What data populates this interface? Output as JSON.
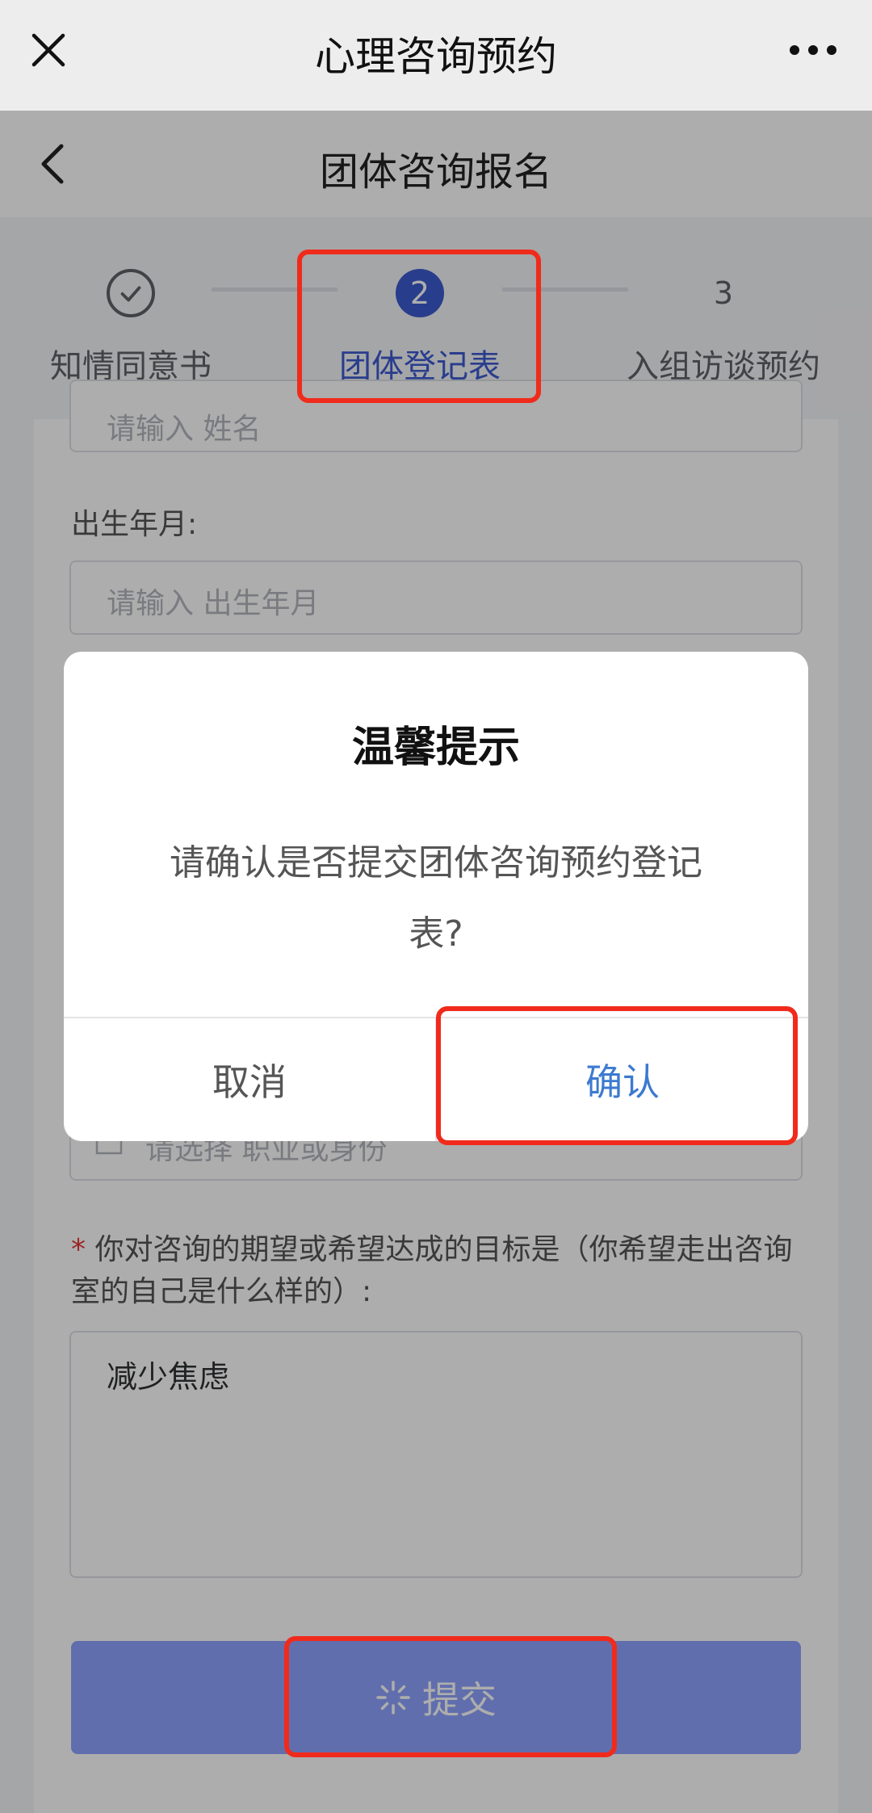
{
  "wechat_bar": {
    "title": "心理咨询预约"
  },
  "header": {
    "title": "团体咨询报名"
  },
  "steps": [
    {
      "index": "",
      "label": "知情同意书",
      "state": "done"
    },
    {
      "index": "2",
      "label": "团体登记表",
      "state": "active"
    },
    {
      "index": "3",
      "label": "入组访谈预约",
      "state": "pending"
    }
  ],
  "form": {
    "name_placeholder_partial": "请输入 姓名",
    "birth_label": "出生年月:",
    "birth_placeholder": "请输入 出生年月",
    "occupation_placeholder": "请选择 职业或身份",
    "goal_required_mark": "*",
    "goal_label": "你对咨询的期望或希望达成的目标是（你希望走出咨询室的自己是什么样的）:",
    "goal_value": "减少焦虑",
    "submit_label": "提交"
  },
  "dialog": {
    "title": "温馨提示",
    "message": "请确认是否提交团体咨询预约登记表?",
    "cancel_label": "取消",
    "confirm_label": "确认"
  },
  "colors": {
    "accent": "#3d5ad0",
    "confirm": "#3d7ad0",
    "highlight": "#f02b1c",
    "submit": "#8fa2ff"
  }
}
